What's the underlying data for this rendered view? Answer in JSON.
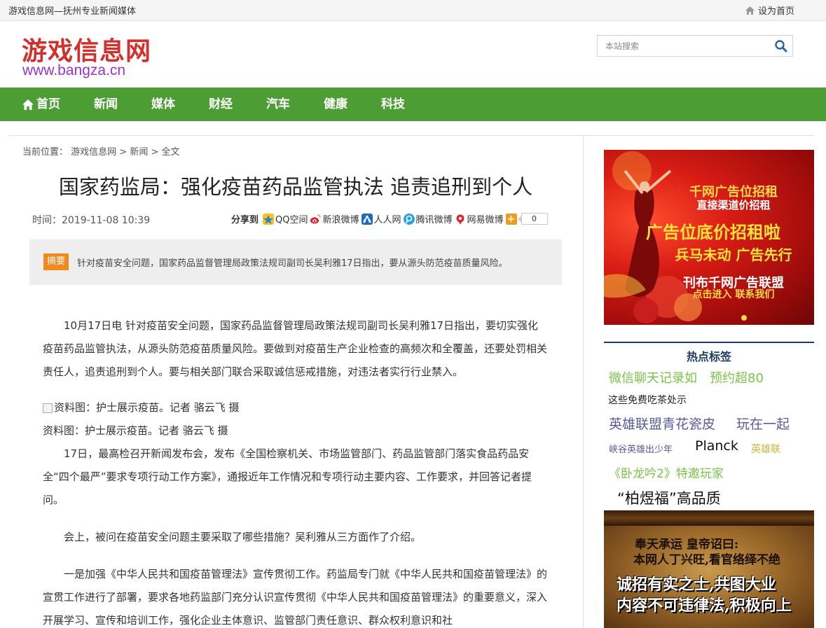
{
  "topbar": {
    "site_desc": "游戏信息网—抚州专业新闻媒体",
    "set_home": "设为首页",
    "set_home_icon": "home-icon"
  },
  "header": {
    "logo_cn": "游戏信息网",
    "logo_en": "www.bangza.cn",
    "search_placeholder": "本站搜索",
    "search_icon": "search-icon"
  },
  "nav": {
    "items": [
      "首页",
      "新闻",
      "媒体",
      "财经",
      "汽车",
      "健康",
      "科技"
    ],
    "home_icon": "home-icon",
    "bg_color": "#4c9d34"
  },
  "breadcrumb": {
    "prefix": "当前位置：",
    "crumb1": "游戏信息网",
    "sep1": " > ",
    "crumb2": "新闻",
    "sep2": " > ",
    "crumb3": "全文"
  },
  "article": {
    "title": "国家药监局：强化疫苗药品监管执法 追责追刑到个人",
    "time": "时间：2019-11-08 10:39",
    "share_label": "分享到",
    "share_items": [
      "QQ空间",
      "新浪微博",
      "人人网",
      "腾讯微博",
      "网易微博"
    ],
    "share_count": "0",
    "summary_tag": "摘要",
    "summary_text": "针对疫苗安全问题，国家药品监督管理局政策法规司副司长吴利雅17日指出，要从源头防范疫苗质量风险。",
    "para1": "10月17日电 针对疫苗安全问题，国家药品监督管理局政策法规司副司长吴利雅17日指出，要切实强化疫苗药品监管执法，从源头防范疫苗质量风险。要做到对疫苗生产企业检查的高频次和全覆盖，还要处罚相关责任人，追责追刑到个人。要与相关部门联合采取诚信惩戒措施，对违法者实行行业禁入。",
    "img_alt": "资料图：护士展示疫苗。记者 骆云飞 摄",
    "img_caption": "资料图：护士展示疫苗。记者 骆云飞 摄",
    "para2": "17日，最高检召开新闻发布会，发布《全国检察机关、市场监管部门、药品监管部门落实食品药品安全“四个最严”要求专项行动工作方案》，通报近年工作情况和专项行动主要内容、工作要求，并回答记者提问。",
    "para3": "会上，被问在疫苗安全问题主要采取了哪些措施？吴利雅从三方面作了介绍。",
    "para4": "一是加强《中华人民共和国疫苗管理法》宣传贯彻工作。药监局专门就《中华人民共和国疫苗管理法》的宣贯工作进行了部署，要求各地药监部门充分认识宣传贯彻《中华人民共和国疫苗管理法》的重要意义，深入开展学习、宣传和培训工作，强化企业主体意识、监管部门责任意识、群众权利意识和社"
  },
  "sidebar": {
    "ad1": {
      "line1": "千网广告位招租",
      "line2": "直接渠道价招租",
      "line3": "广告位底价招租啦",
      "line4": "兵马未动 广告先行",
      "line5": "刊布千网广告联盟",
      "line6": "点击进入 联系我们"
    },
    "hot_title": "热点标签",
    "tags": [
      {
        "text": "微信聊天记录如",
        "color": "#7cc24a"
      },
      {
        "text": "预约超80",
        "color": "#7cc24a"
      },
      {
        "text": "这些免费吃茶处示",
        "color": "#222222"
      },
      {
        "text": "英雄联盟青花瓷皮",
        "color": "#5a5a9a"
      },
      {
        "text": "玩在一起",
        "color": "#5a5a9a"
      },
      {
        "text": "峡谷英雄出少年",
        "color": "#5a5a9a"
      },
      {
        "text": "Planck",
        "color": "#111111"
      },
      {
        "text": "英雄联",
        "color": "#c8b43a"
      },
      {
        "text": "《卧龙吟2》特邀玩家",
        "color": "#7cc24a"
      },
      {
        "text": "“柏煜福”高品质",
        "color": "#111111"
      }
    ],
    "ad2": {
      "line1": "奉天承运 皇帝诏曰:",
      "line2": "本网人丁兴旺,看官络绎不绝",
      "line3": "诚招有实之士,共图大业",
      "line4": "内容不可违律法,积极向上"
    }
  }
}
